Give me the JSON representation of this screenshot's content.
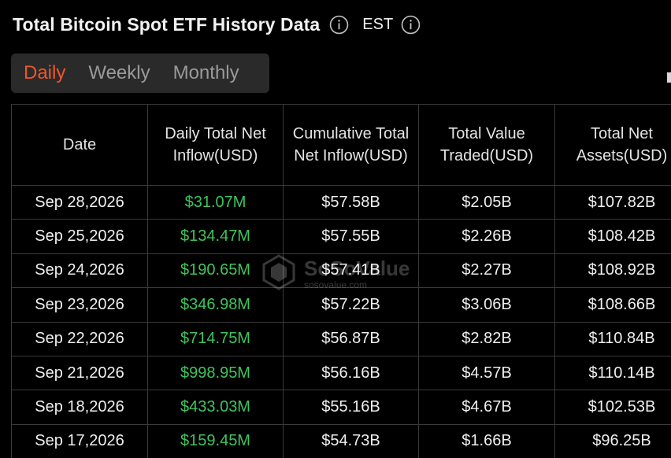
{
  "header": {
    "title": "Total Bitcoin Spot ETF History Data",
    "timezone": "EST",
    "title_info_icon": "info-icon",
    "timezone_info_icon": "info-icon"
  },
  "tabs": [
    {
      "label": "Daily",
      "active": true
    },
    {
      "label": "Weekly",
      "active": false
    },
    {
      "label": "Monthly",
      "active": false
    }
  ],
  "table": {
    "columns": [
      "Date",
      "Daily Total Net Inflow(USD)",
      "Cumulative Total Net Inflow(USD)",
      "Total Value Traded(USD)",
      "Total Net Assets(USD)"
    ],
    "rows": [
      [
        "Sep 28,2026",
        "$31.07M",
        "$57.58B",
        "$2.05B",
        "$107.82B"
      ],
      [
        "Sep 25,2026",
        "$134.47M",
        "$57.55B",
        "$2.26B",
        "$108.42B"
      ],
      [
        "Sep 24,2026",
        "$190.65M",
        "$57.41B",
        "$2.27B",
        "$108.92B"
      ],
      [
        "Sep 23,2026",
        "$346.98M",
        "$57.22B",
        "$3.06B",
        "$108.66B"
      ],
      [
        "Sep 22,2026",
        "$714.75M",
        "$56.87B",
        "$2.82B",
        "$110.84B"
      ],
      [
        "Sep 21,2026",
        "$998.95M",
        "$56.16B",
        "$4.57B",
        "$110.14B"
      ],
      [
        "Sep 18,2026",
        "$433.03M",
        "$55.16B",
        "$4.67B",
        "$102.53B"
      ],
      [
        "Sep 17,2026",
        "$159.45M",
        "$54.73B",
        "$1.66B",
        "$96.25B"
      ]
    ]
  },
  "watermark": {
    "name": "SoSoValue",
    "url": "sosovalue.com"
  },
  "colors": {
    "background": "#000000",
    "active_tab": "#f0552e",
    "positive": "#3fc45c",
    "tab_bar": "#2a2a2a",
    "border": "#3a3a3a"
  }
}
